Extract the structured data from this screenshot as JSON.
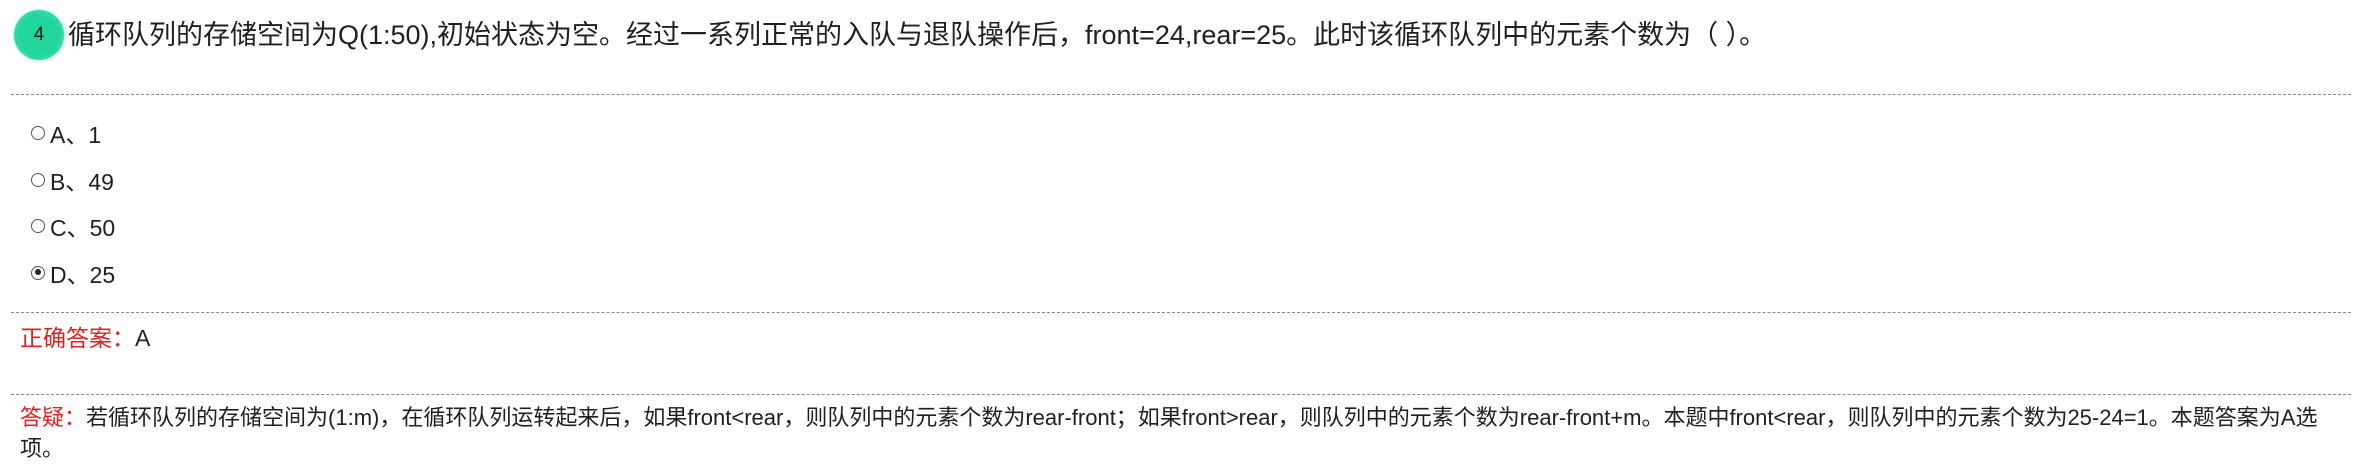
{
  "question": {
    "number": "4",
    "text": "循环队列的存储空间为Q(1:50),初始状态为空。经过一系列正常的入队与退队操作后，front=24,rear=25。此时该循环队列中的元素个数为（  ）。"
  },
  "options": [
    {
      "label": "A、1",
      "selected": false
    },
    {
      "label": "B、49",
      "selected": false
    },
    {
      "label": "C、50",
      "selected": false
    },
    {
      "label": "D、25",
      "selected": true
    }
  ],
  "answer": {
    "label": "正确答案：",
    "value": "A"
  },
  "explanation": {
    "label": "答疑：",
    "text": "若循环队列的存储空间为(1:m)，在循环队列运转起来后，如果front<rear，则队列中的元素个数为rear-front；如果front>rear，则队列中的元素个数为rear-front+m。本题中front<rear，则队列中的元素个数为25-24=1。本题答案为A选项。"
  },
  "colors": {
    "badge": "#22d59c",
    "label_red": "#e02020",
    "divider": "#8a8a8a"
  }
}
